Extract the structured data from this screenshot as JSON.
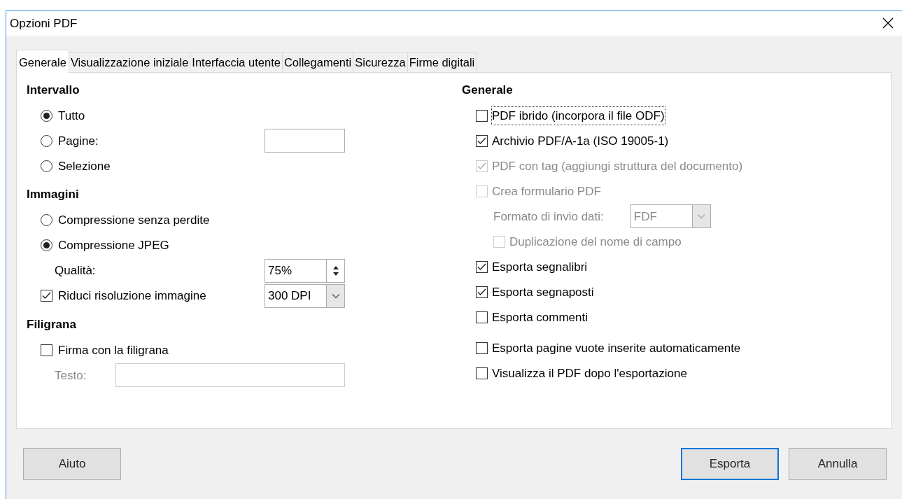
{
  "window": {
    "title": "Opzioni PDF"
  },
  "tabs": [
    {
      "label": "Generale",
      "selected": true
    },
    {
      "label": "Visualizzazione iniziale",
      "selected": false
    },
    {
      "label": "Interfaccia utente",
      "selected": false
    },
    {
      "label": "Collegamenti",
      "selected": false
    },
    {
      "label": "Sicurezza",
      "selected": false
    },
    {
      "label": "Firme digitali",
      "selected": false
    }
  ],
  "left_sections": [
    {
      "heading": "Intervallo",
      "items": [
        {
          "kind": "radio",
          "label": "Tutto",
          "selected": true
        },
        {
          "kind": "radio-field",
          "label": "Pagine:",
          "selected": false
        },
        {
          "kind": "radio",
          "label": "Selezione",
          "selected": false
        }
      ]
    },
    {
      "heading": "Immagini",
      "items": [
        {
          "kind": "radio",
          "label": "Compressione senza perdite",
          "selected": false
        },
        {
          "kind": "radio",
          "label": "Compressione JPEG",
          "selected": true
        },
        {
          "kind": "spin",
          "label": "Qualità:",
          "value": "75%"
        },
        {
          "kind": "checkbox-select",
          "label": "Riduci risoluzione immagine",
          "checked": true,
          "value": "300 DPI"
        }
      ]
    },
    {
      "heading": "Filigrana",
      "items": [
        {
          "kind": "checkbox",
          "label": "Firma con la filigrana",
          "checked": false
        },
        {
          "kind": "text-field",
          "label": "Testo:",
          "disabled": true
        }
      ]
    }
  ],
  "right_section": {
    "heading": "Generale",
    "groups": [
      {
        "items": [
          {
            "kind": "checkbox",
            "label": "PDF ibrido (incorpora il file ODF)",
            "checked": false,
            "disabled": false,
            "focused": true
          },
          {
            "kind": "checkbox",
            "label": "Archivio PDF/A-1a (ISO 19005-1)",
            "checked": true,
            "disabled": false,
            "focused": false
          },
          {
            "kind": "checkbox",
            "label": "PDF con tag (aggiungi struttura del documento)",
            "checked": true,
            "disabled": true,
            "focused": false
          },
          {
            "kind": "checkbox",
            "label": "Crea formulario PDF",
            "checked": false,
            "disabled": true,
            "focused": false,
            "children": [
              {
                "kind": "select",
                "label": "Formato di invio dati:",
                "value": "FDF",
                "disabled": true
              },
              {
                "kind": "checkbox",
                "label": "Duplicazione del nome di campo",
                "checked": false,
                "disabled": true,
                "focused": false
              }
            ]
          },
          {
            "kind": "checkbox",
            "label": "Esporta segnalibri",
            "checked": true,
            "disabled": false,
            "focused": false
          },
          {
            "kind": "checkbox",
            "label": "Esporta segnaposti",
            "checked": true,
            "disabled": false,
            "focused": false
          },
          {
            "kind": "checkbox",
            "label": "Esporta commenti",
            "checked": false,
            "disabled": false,
            "focused": false
          }
        ]
      },
      {
        "items": [
          {
            "kind": "checkbox",
            "label": "Esporta pagine vuote inserite automaticamente",
            "checked": false,
            "disabled": false,
            "focused": false
          },
          {
            "kind": "checkbox",
            "label": "Visualizza il PDF dopo l'esportazione",
            "checked": false,
            "disabled": false,
            "focused": false
          }
        ]
      }
    ]
  },
  "help_button": {
    "label": "Aiuto"
  },
  "buttons": [
    {
      "label": "Esporta",
      "default": true
    },
    {
      "label": "Annulla",
      "default": false
    }
  ]
}
